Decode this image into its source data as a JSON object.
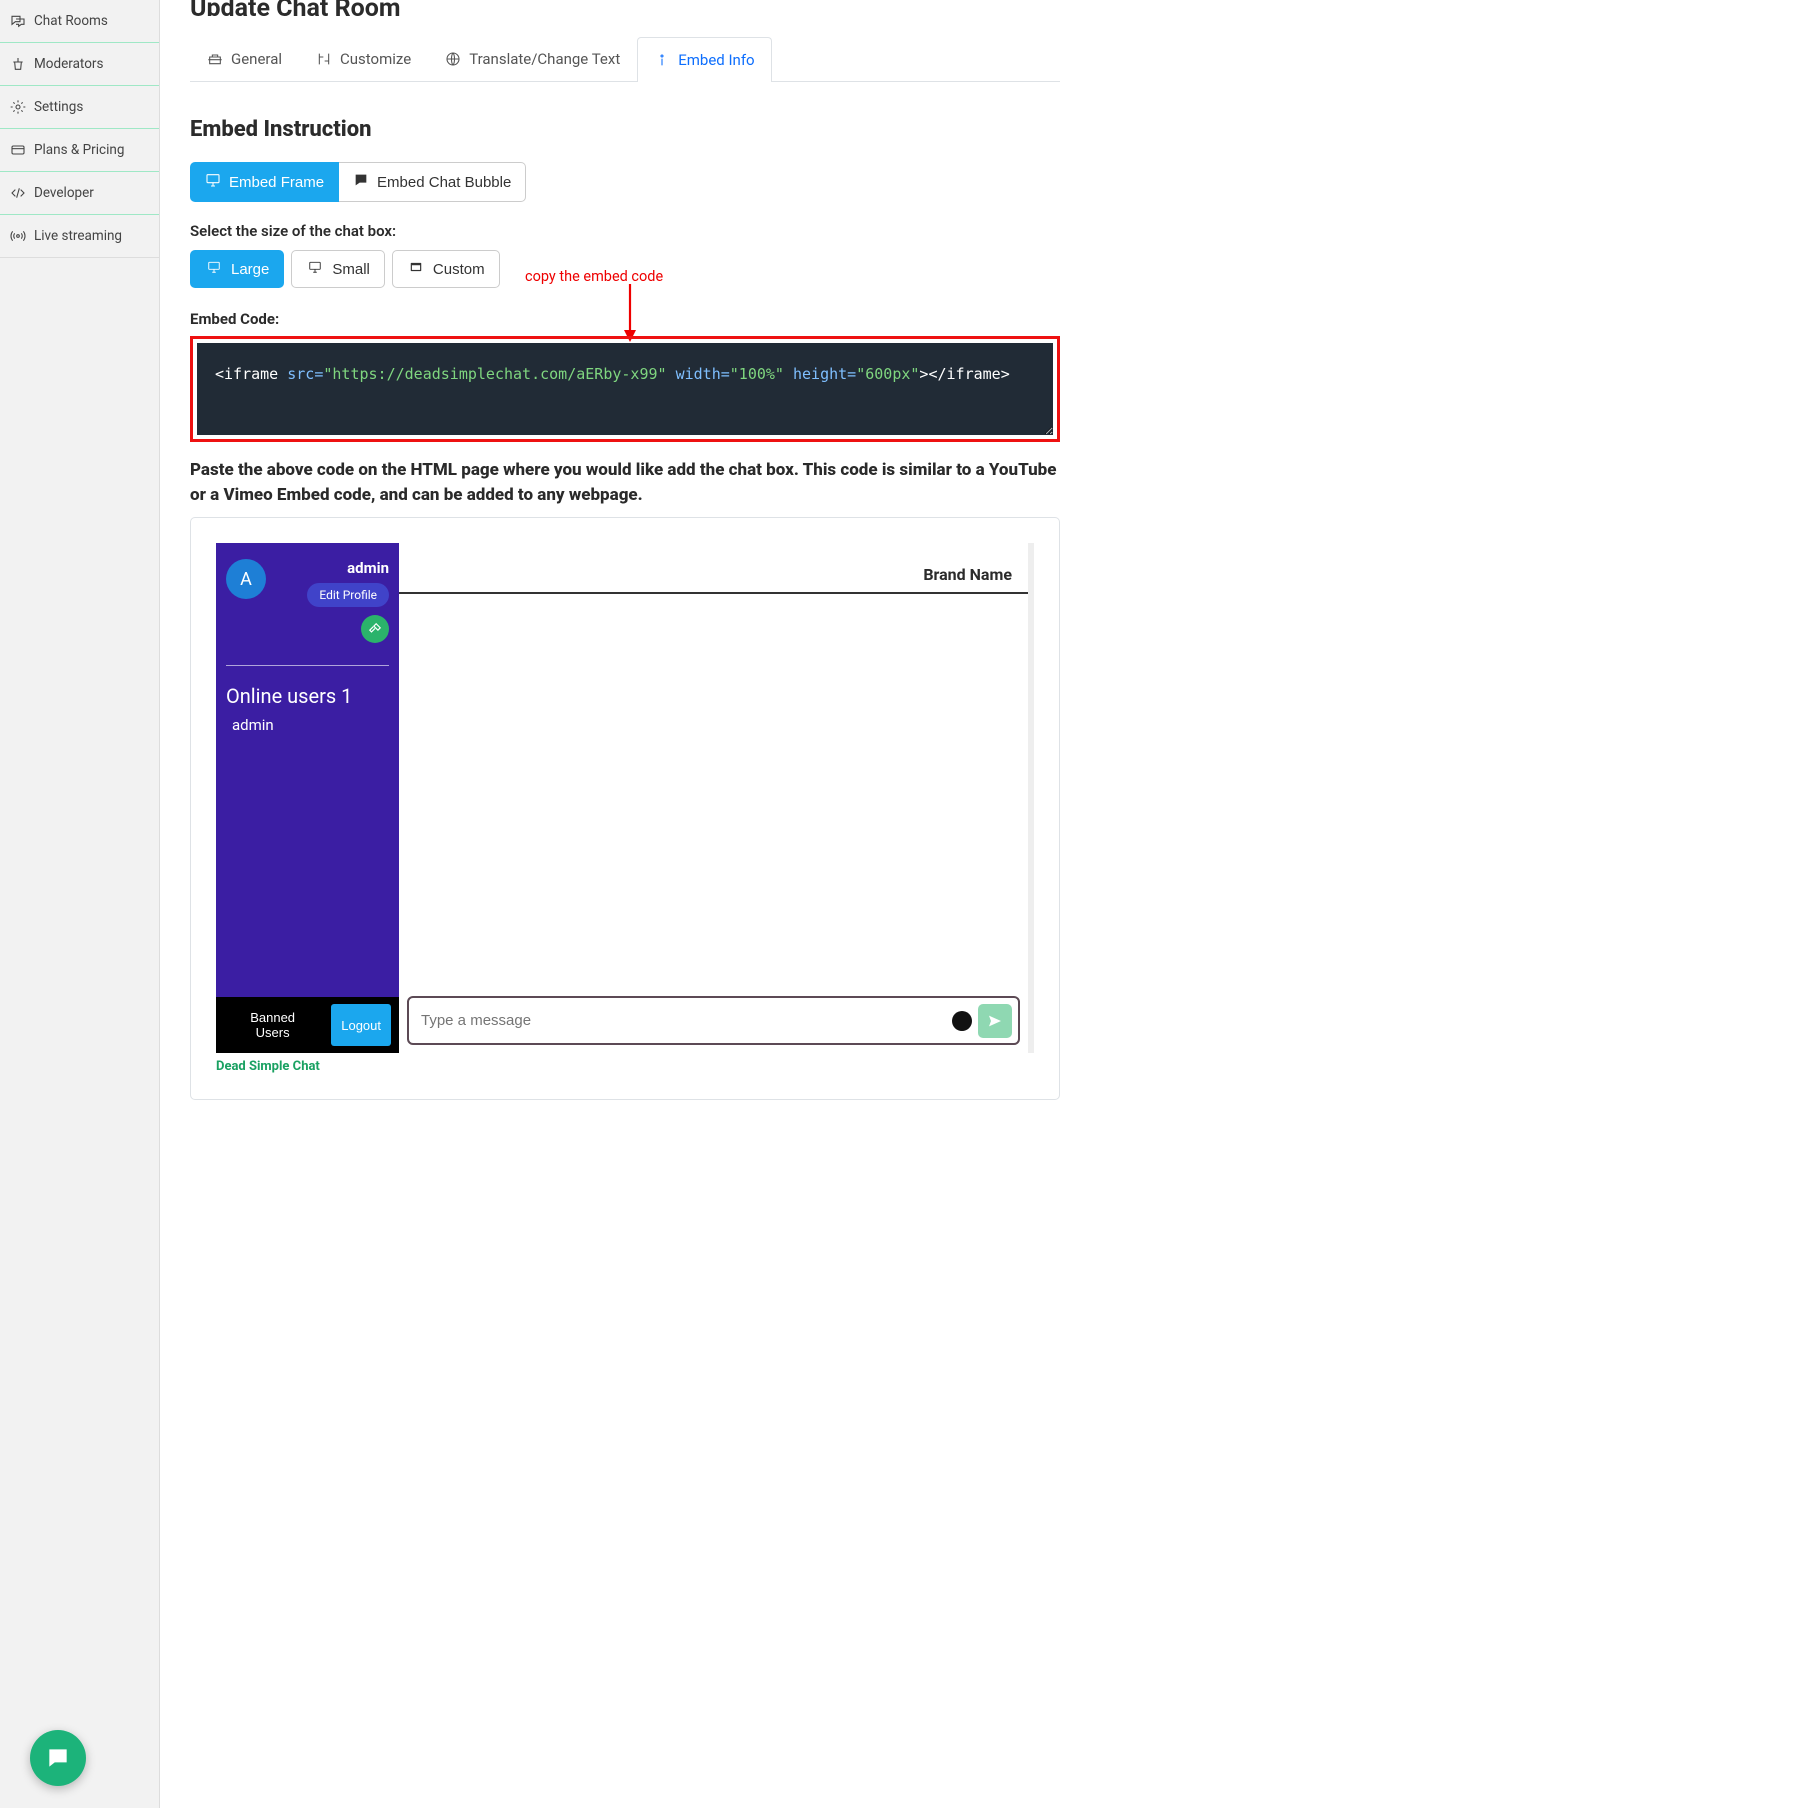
{
  "sidebar": {
    "items": [
      {
        "label": "Chat Rooms",
        "icon": "chat-rooms-icon"
      },
      {
        "label": "Moderators",
        "icon": "moderators-icon"
      },
      {
        "label": "Settings",
        "icon": "settings-icon"
      },
      {
        "label": "Plans & Pricing",
        "icon": "plans-icon"
      },
      {
        "label": "Developer",
        "icon": "developer-icon"
      },
      {
        "label": "Live streaming",
        "icon": "live-icon"
      }
    ]
  },
  "page": {
    "title": "Update Chat Room"
  },
  "tabs": {
    "general": "General",
    "customize": "Customize",
    "translate": "Translate/Change Text",
    "embed": "Embed Info"
  },
  "embed": {
    "section_title": "Embed Instruction",
    "frame_btn": "Embed Frame",
    "bubble_btn": "Embed Chat Bubble",
    "size_label": "Select the size of the chat box:",
    "sizes": {
      "large": "Large",
      "small": "Small",
      "custom": "Custom"
    },
    "code_label": "Embed Code:",
    "code_value": "<iframe src=\"https://deadsimplechat.com/aERby-x99\" width=\"100%\" height=\"600px\"></iframe>",
    "annotation": "copy the embed code",
    "instruction": "Paste the above code on the HTML page where you would like add the chat box. This code is similar to a YouTube or a Vimeo Embed code, and can be added to any webpage."
  },
  "chat": {
    "avatar_letter": "A",
    "username": "admin",
    "edit_profile": "Edit Profile",
    "online_title": "Online users 1",
    "online_user": "admin",
    "banned_btn": "Banned Users",
    "logout_btn": "Logout",
    "brand_link": "Dead Simple Chat",
    "header_brand": "Brand Name",
    "input_placeholder": "Type a message"
  }
}
